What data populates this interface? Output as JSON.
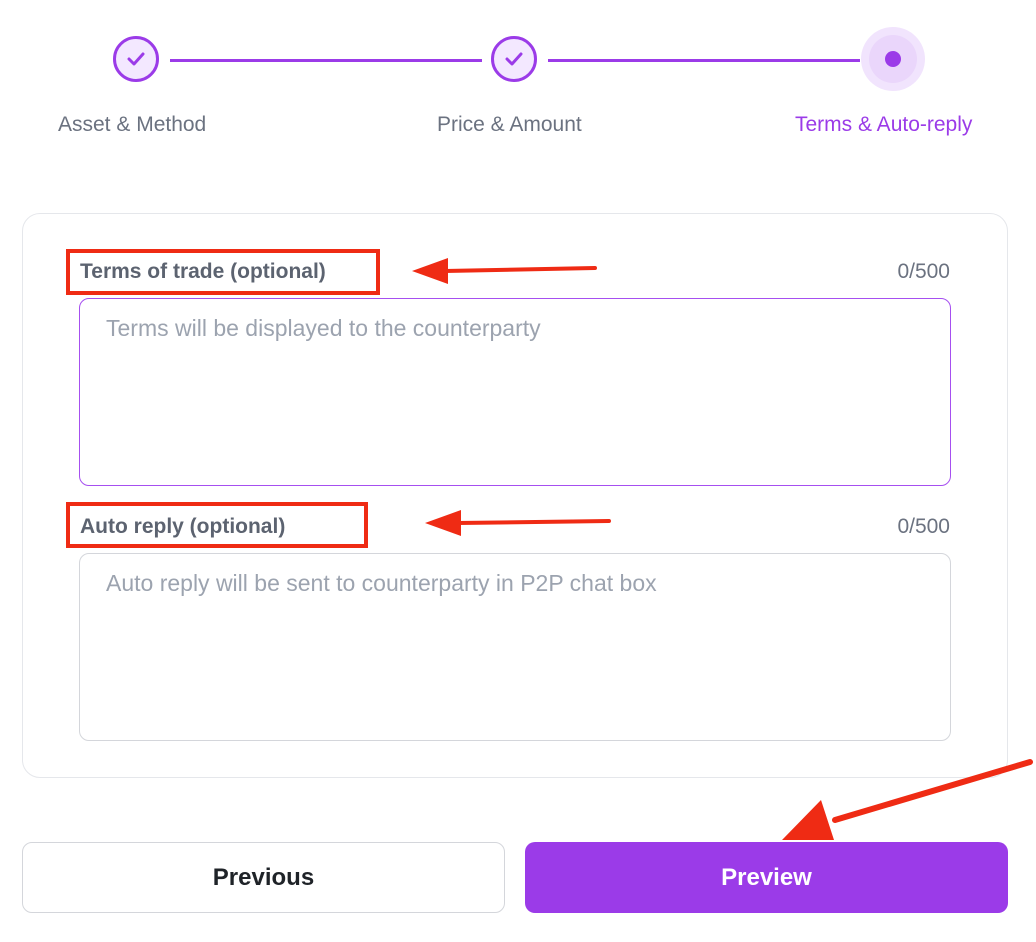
{
  "stepper": {
    "steps": [
      {
        "label": "Asset & Method",
        "state": "completed"
      },
      {
        "label": "Price & Amount",
        "state": "completed"
      },
      {
        "label": "Terms & Auto-reply",
        "state": "active"
      }
    ],
    "accent_color": "#9b3be8"
  },
  "form": {
    "terms": {
      "label": "Terms of trade (optional)",
      "counter": "0/500",
      "placeholder": "Terms will be displayed to the counterparty",
      "value": ""
    },
    "auto_reply": {
      "label": "Auto reply (optional)",
      "counter": "0/500",
      "placeholder": "Auto reply will be sent to counterparty in P2P chat box",
      "value": ""
    }
  },
  "actions": {
    "previous_label": "Previous",
    "preview_label": "Preview"
  },
  "annotations": {
    "highlight_color": "#ef2b14"
  }
}
